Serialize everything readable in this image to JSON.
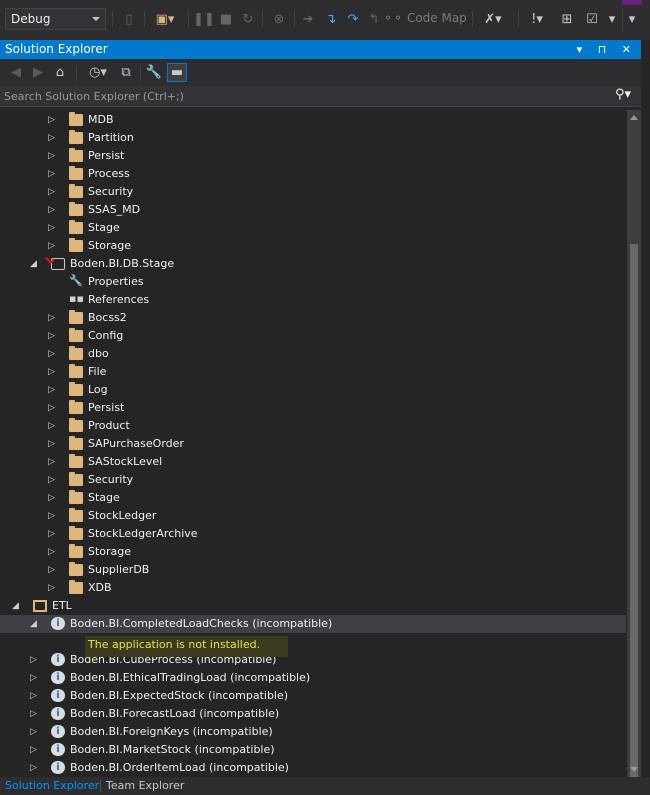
{
  "toolbar": {
    "configuration": "Debug",
    "code_map_label": "Code Map"
  },
  "solution_explorer": {
    "title": "Solution Explorer",
    "title_controls": "▾ ⊓ ✕",
    "search_placeholder": "Search Solution Explorer (Ctrl+;)"
  },
  "tree": {
    "rows": [
      {
        "label": "MDB",
        "icon": "folder-icon",
        "expander": "collapsed"
      },
      {
        "label": "Partition",
        "icon": "folder-icon",
        "expander": "collapsed"
      },
      {
        "label": "Persist",
        "icon": "folder-icon",
        "expander": "collapsed"
      },
      {
        "label": "Process",
        "icon": "folder-icon",
        "expander": "collapsed"
      },
      {
        "label": "Security",
        "icon": "folder-icon",
        "expander": "collapsed"
      },
      {
        "label": "SSAS_MD",
        "icon": "folder-icon",
        "expander": "collapsed"
      },
      {
        "label": "Stage",
        "icon": "folder-icon",
        "expander": "collapsed"
      },
      {
        "label": "Storage",
        "icon": "folder-icon",
        "expander": "collapsed"
      },
      {
        "label": "Boden.BI.DB.Stage",
        "icon": "database-project-icon",
        "expander": "expanded"
      },
      {
        "label": "Properties",
        "icon": "wrench-icon",
        "expander": "none"
      },
      {
        "label": "References",
        "icon": "references-icon",
        "expander": "none"
      },
      {
        "label": "Bocss2",
        "icon": "folder-icon",
        "expander": "collapsed"
      },
      {
        "label": "Config",
        "icon": "folder-icon",
        "expander": "collapsed"
      },
      {
        "label": "dbo",
        "icon": "folder-icon",
        "expander": "collapsed"
      },
      {
        "label": "File",
        "icon": "folder-icon",
        "expander": "collapsed"
      },
      {
        "label": "Log",
        "icon": "folder-icon",
        "expander": "collapsed"
      },
      {
        "label": "Persist",
        "icon": "folder-icon",
        "expander": "collapsed"
      },
      {
        "label": "Product",
        "icon": "folder-icon",
        "expander": "collapsed"
      },
      {
        "label": "SAPurchaseOrder",
        "icon": "folder-icon",
        "expander": "collapsed"
      },
      {
        "label": "SAStockLevel",
        "icon": "folder-icon",
        "expander": "collapsed"
      },
      {
        "label": "Security",
        "icon": "folder-icon",
        "expander": "collapsed"
      },
      {
        "label": "Stage",
        "icon": "folder-icon",
        "expander": "collapsed"
      },
      {
        "label": "StockLedger",
        "icon": "folder-icon",
        "expander": "collapsed"
      },
      {
        "label": "StockLedgerArchive",
        "icon": "folder-icon",
        "expander": "collapsed"
      },
      {
        "label": "Storage",
        "icon": "folder-icon",
        "expander": "collapsed"
      },
      {
        "label": "SupplierDB",
        "icon": "folder-icon",
        "expander": "collapsed"
      },
      {
        "label": "XDB",
        "icon": "folder-icon",
        "expander": "collapsed"
      },
      {
        "label": "ETL",
        "icon": "folder-open-icon",
        "expander": "expanded"
      },
      {
        "label": "Boden.BI.CompletedLoadChecks (incompatible)",
        "icon": "project-icon",
        "expander": "expanded"
      },
      {
        "label": "Boden.BI.CubeProcess (incompatible)",
        "icon": "project-icon",
        "expander": "collapsed"
      },
      {
        "label": "Boden.BI.EthicalTradingLoad (incompatible)",
        "icon": "project-icon",
        "expander": "collapsed"
      },
      {
        "label": "Boden.BI.ExpectedStock (incompatible)",
        "icon": "project-icon",
        "expander": "collapsed"
      },
      {
        "label": "Boden.BI.ForecastLoad (incompatible)",
        "icon": "project-icon",
        "expander": "collapsed"
      },
      {
        "label": "Boden.BI.ForeignKeys (incompatible)",
        "icon": "project-icon",
        "expander": "collapsed"
      },
      {
        "label": "Boden.BI.MarketStock (incompatible)",
        "icon": "project-icon",
        "expander": "collapsed"
      },
      {
        "label": "Boden.BI.OrderItemLoad (incompatible)",
        "icon": "project-icon",
        "expander": "collapsed"
      }
    ],
    "notice": "The application is not installed."
  },
  "bottom_tabs": {
    "solution_explorer": "Solution Explorer",
    "team_explorer": "Team Explorer"
  }
}
